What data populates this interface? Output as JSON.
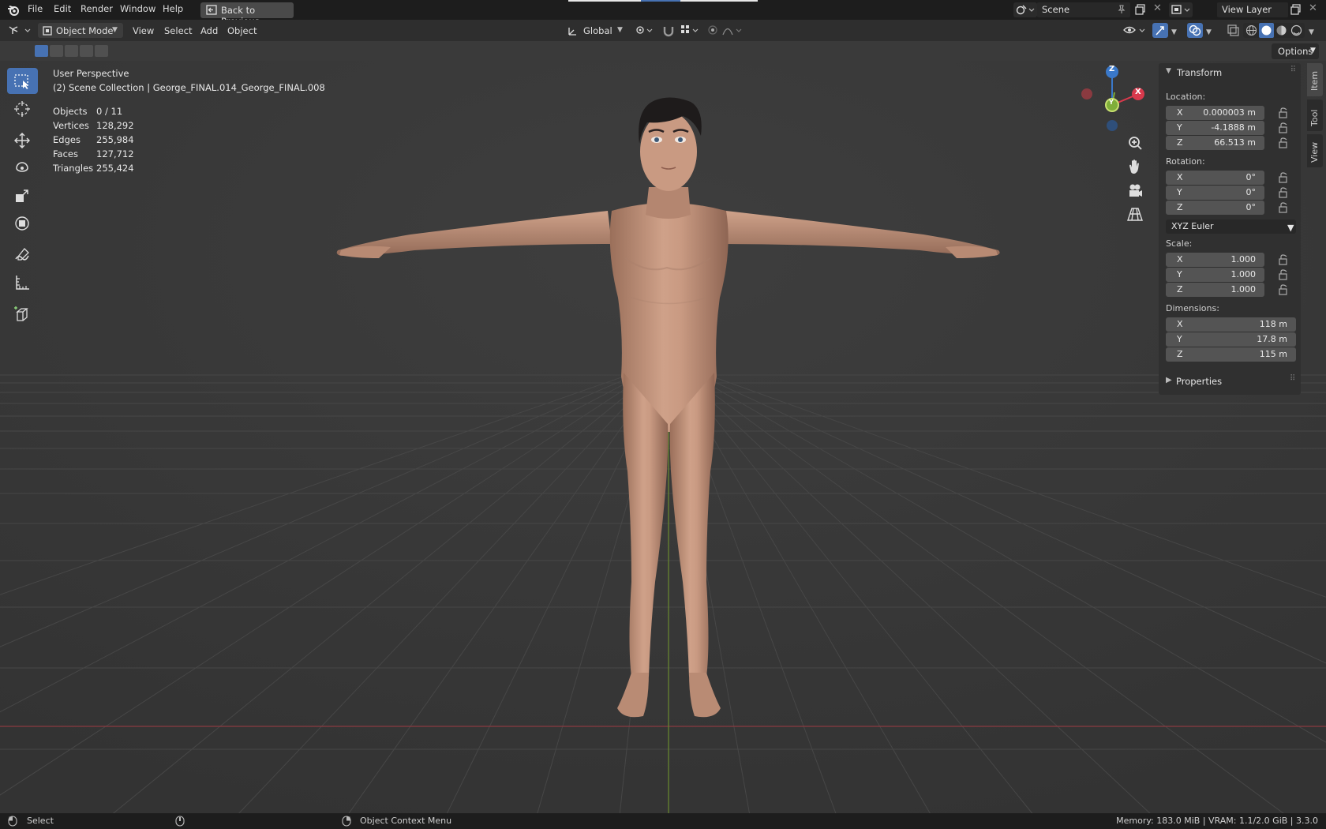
{
  "menu": {
    "file": "File",
    "edit": "Edit",
    "render": "Render",
    "window": "Window",
    "help": "Help",
    "back": "Back to Previous"
  },
  "scene": {
    "name": "Scene",
    "view_layer": "View Layer"
  },
  "header": {
    "mode": "Object Mode",
    "view": "View",
    "select": "Select",
    "add": "Add",
    "object": "Object",
    "orientation": "Global",
    "options": "Options"
  },
  "overlay": {
    "perspective": "User Perspective",
    "collection": "(2) Scene Collection | George_FINAL.014_George_FINAL.008",
    "stats": [
      {
        "label": "Objects",
        "value": "0 / 11"
      },
      {
        "label": "Vertices",
        "value": "128,292"
      },
      {
        "label": "Edges",
        "value": "255,984"
      },
      {
        "label": "Faces",
        "value": "127,712"
      },
      {
        "label": "Triangles",
        "value": "255,424"
      }
    ]
  },
  "gizmo": {
    "z": "Z",
    "x": "X",
    "y": "Y"
  },
  "panel": {
    "transform": "Transform",
    "location_label": "Location:",
    "location": [
      {
        "axis": "X",
        "value": "0.000003 m"
      },
      {
        "axis": "Y",
        "value": "-4.1888 m"
      },
      {
        "axis": "Z",
        "value": "66.513 m"
      }
    ],
    "rotation_label": "Rotation:",
    "rotation": [
      {
        "axis": "X",
        "value": "0°"
      },
      {
        "axis": "Y",
        "value": "0°"
      },
      {
        "axis": "Z",
        "value": "0°"
      }
    ],
    "rotation_mode": "XYZ Euler",
    "scale_label": "Scale:",
    "scale": [
      {
        "axis": "X",
        "value": "1.000"
      },
      {
        "axis": "Y",
        "value": "1.000"
      },
      {
        "axis": "Z",
        "value": "1.000"
      }
    ],
    "dimensions_label": "Dimensions:",
    "dimensions": [
      {
        "axis": "X",
        "value": "118 m"
      },
      {
        "axis": "Y",
        "value": "17.8 m"
      },
      {
        "axis": "Z",
        "value": "115 m"
      }
    ],
    "properties": "Properties",
    "tabs": [
      "Item",
      "Tool",
      "View"
    ]
  },
  "status": {
    "select": "Select",
    "context": "Object Context Menu",
    "memory": "Memory: 183.0 MiB | VRAM: 1.1/2.0 GiB | 3.3.0"
  },
  "colors": {
    "accent": "#4772b3",
    "x_axis": "#d8394c",
    "y_axis": "#7fae3a",
    "z_axis": "#3a78c9",
    "skin": "#c89a82",
    "hair": "#1e1b1b"
  }
}
